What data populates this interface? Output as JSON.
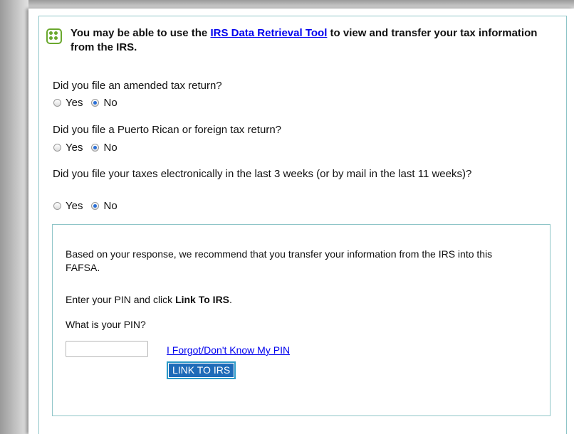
{
  "info": {
    "prefix": "You may be able to use the ",
    "link": "IRS Data Retrieval Tool",
    "suffix": " to view and transfer your tax information from the IRS."
  },
  "questions": [
    {
      "text": "Did you file an amended tax return?",
      "yes": "Yes",
      "no": "No",
      "selected": "No"
    },
    {
      "text": "Did you file a Puerto Rican or foreign tax return?",
      "yes": "Yes",
      "no": "No",
      "selected": "No"
    },
    {
      "text": "Did you file your taxes electronically in the last 3 weeks (or by mail in the last 11 weeks)?",
      "yes": "Yes",
      "no": "No",
      "selected": "No"
    }
  ],
  "recommendation": {
    "message": "Based on your response, we recommend that you transfer your information from the IRS into this FAFSA.",
    "instruction_prefix": "Enter your PIN and click ",
    "instruction_bold": "Link To IRS",
    "instruction_suffix": ".",
    "pin_label": "What is your PIN?",
    "pin_value": "",
    "forgot_link": "I Forgot/Don't Know My PIN",
    "link_button": "LINK TO IRS"
  },
  "colors": {
    "accent_border": "#8fc5c8",
    "button_bg": "#1e6bb8",
    "icon_green": "#6aa82e"
  }
}
